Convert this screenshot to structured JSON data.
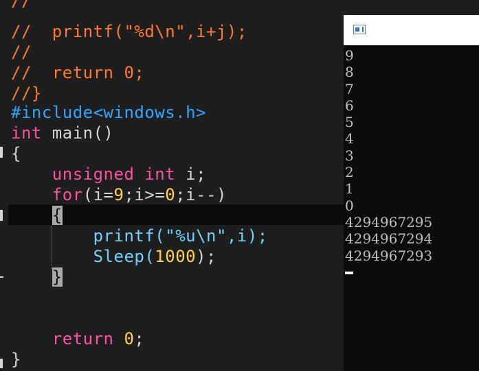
{
  "editor": {
    "lines": [
      [
        {
          "t": "//",
          "c": "comment"
        }
      ],
      [
        {
          "t": "//  printf(\"%d\\n\",i+j);",
          "c": "comment"
        }
      ],
      [
        {
          "t": "//",
          "c": "comment"
        }
      ],
      [
        {
          "t": "//  return 0;",
          "c": "comment"
        }
      ],
      [
        {
          "t": "//}",
          "c": "comment"
        }
      ],
      [
        {
          "t": "#include<windows.h>",
          "c": "pre"
        }
      ],
      [
        {
          "t": "int",
          "c": "kw"
        },
        {
          "t": " main()",
          "c": "plain"
        }
      ],
      [
        {
          "t": "{",
          "c": "plain"
        }
      ],
      [
        {
          "t": "    ",
          "c": "plain"
        },
        {
          "t": "unsigned int",
          "c": "kw"
        },
        {
          "t": " i;",
          "c": "plain"
        }
      ],
      [
        {
          "t": "    ",
          "c": "plain"
        },
        {
          "t": "for",
          "c": "kw"
        },
        {
          "t": "(i=",
          "c": "plain"
        },
        {
          "t": "9",
          "c": "num"
        },
        {
          "t": ";i>=",
          "c": "plain"
        },
        {
          "t": "0",
          "c": "num"
        },
        {
          "t": ";i--)",
          "c": "plain"
        }
      ],
      [
        {
          "t": "    ",
          "c": "plain"
        },
        {
          "t": "{",
          "c": "brace"
        }
      ],
      [
        {
          "t": "        ",
          "c": "plain"
        },
        {
          "t": "printf(\"%u\\n\",i);",
          "c": "fn"
        }
      ],
      [
        {
          "t": "        ",
          "c": "plain"
        },
        {
          "t": "Sleep(",
          "c": "fn"
        },
        {
          "t": "1000",
          "c": "num"
        },
        {
          "t": ");",
          "c": "plain"
        }
      ],
      [
        {
          "t": "    ",
          "c": "plain"
        },
        {
          "t": "}",
          "c": "brace"
        }
      ],
      [],
      [],
      [
        {
          "t": "    ",
          "c": "plain"
        },
        {
          "t": "return",
          "c": "kw"
        },
        {
          "t": " ",
          "c": "plain"
        },
        {
          "t": "0",
          "c": "num"
        },
        {
          "t": ";",
          "c": "plain"
        }
      ],
      [
        {
          "t": "}",
          "c": "plain"
        }
      ]
    ]
  },
  "console": {
    "output_lines": [
      "9",
      "8",
      "7",
      "6",
      "5",
      "4",
      "3",
      "2",
      "1",
      "0",
      "4294967295",
      "4294967294",
      "4294967293"
    ]
  }
}
